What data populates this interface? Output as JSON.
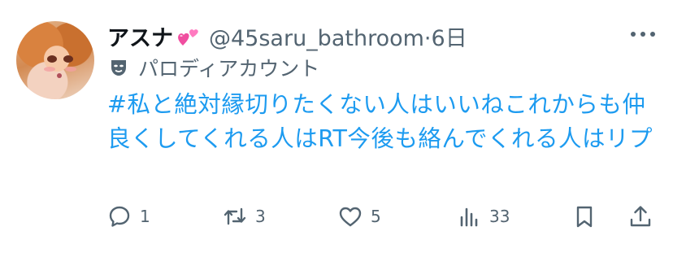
{
  "author": {
    "display_name": "アスナ",
    "name_emoji": "two-hearts-emoji",
    "handle": "@45saru_bathroom",
    "separator": "·",
    "time": "6日",
    "parody_label": "パロディアカウント"
  },
  "tweet": {
    "text": "#私と絶対縁切りたくない人はいいねこれからも仲良くしてくれる人はRT今後も絡んでくれる人はリプ"
  },
  "actions": {
    "reply_count": "1",
    "retweet_count": "3",
    "like_count": "5",
    "view_count": "33"
  },
  "colors": {
    "link": "#1d9bf0",
    "secondary_text": "#536471",
    "primary_text": "#0f1419",
    "heart": "#f04ea0"
  }
}
